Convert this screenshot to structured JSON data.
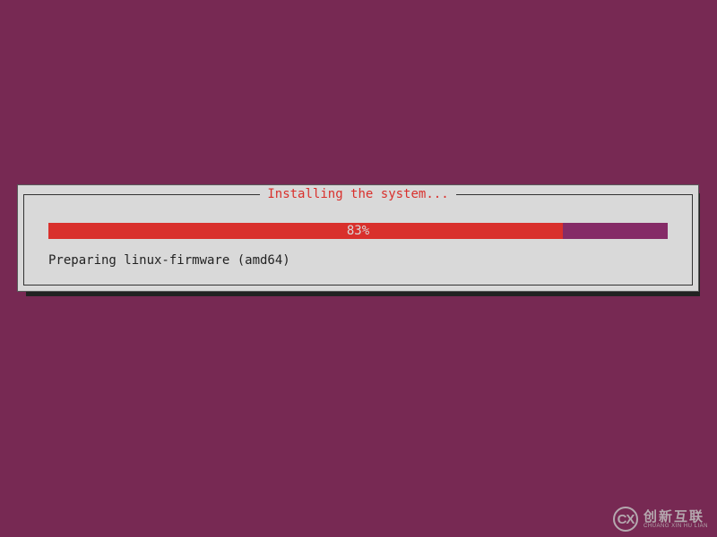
{
  "dialog": {
    "title": "Installing the system...",
    "progress_percent": 83,
    "progress_label": "83%",
    "status": "Preparing linux-firmware (amd64)"
  },
  "watermark": {
    "logo_text": "CX",
    "main": "创新互联",
    "sub": "CHUANG XIN HU LIAN"
  }
}
